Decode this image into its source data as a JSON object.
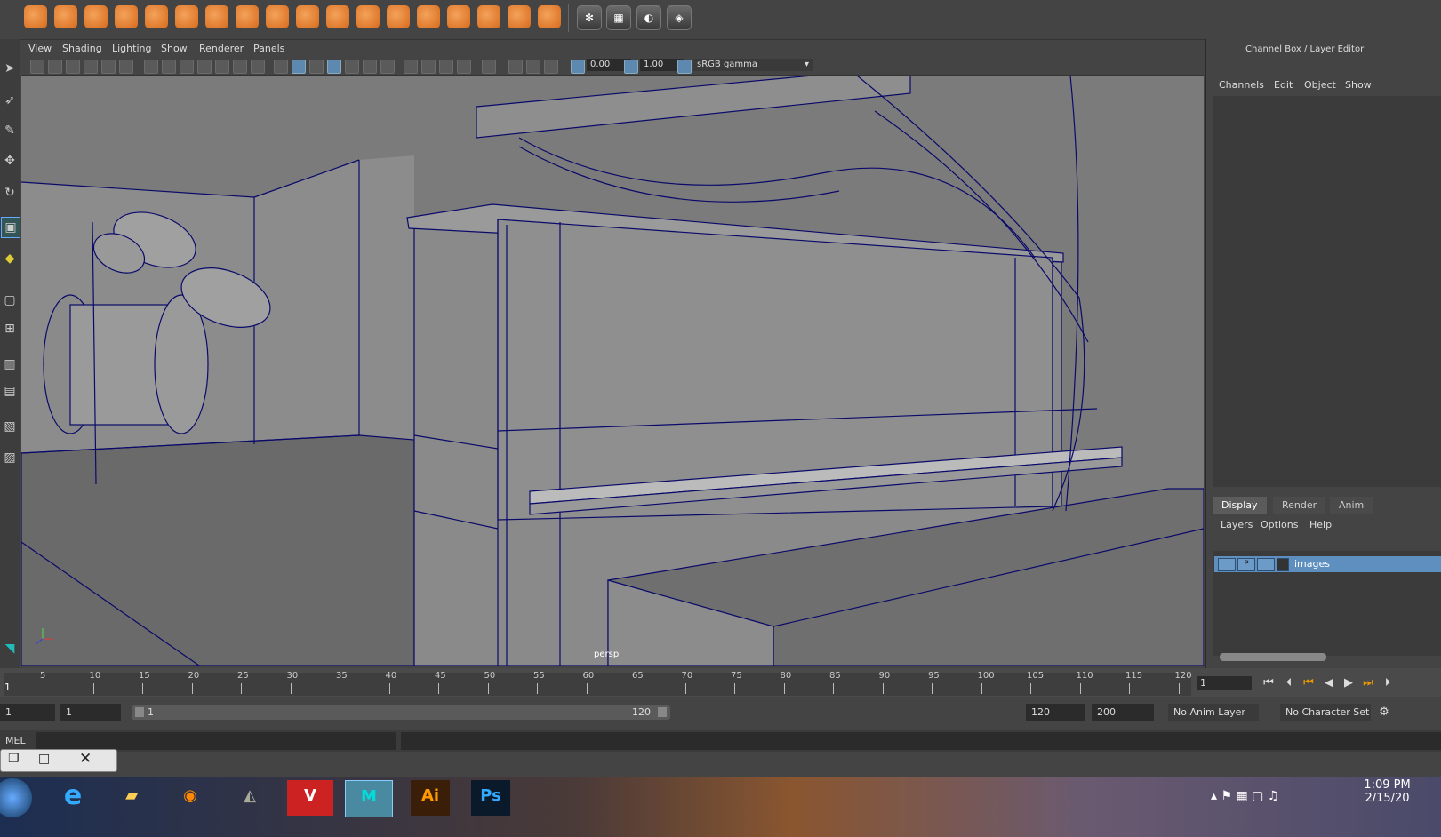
{
  "viewport_menu": [
    "View",
    "Shading",
    "Lighting",
    "Show",
    "Renderer",
    "Panels"
  ],
  "viewport_toolbar": {
    "exposure": "0.00",
    "gamma": "1.00",
    "color_space": "sRGB gamma"
  },
  "viewport": {
    "camera_label": "persp"
  },
  "right_panel": {
    "title": "Channel Box / Layer Editor",
    "channel_menu": [
      "Channels",
      "Edit",
      "Object",
      "Show"
    ],
    "tabs": [
      "Display",
      "Render",
      "Anim"
    ],
    "layer_menu": [
      "Layers",
      "Options",
      "Help"
    ],
    "layer": {
      "name": "images",
      "p_label": "P"
    }
  },
  "timeline": {
    "ticks": [
      "5",
      "10",
      "15",
      "20",
      "25",
      "30",
      "35",
      "40",
      "45",
      "50",
      "55",
      "60",
      "65",
      "70",
      "75",
      "80",
      "85",
      "90",
      "95",
      "100",
      "105",
      "110",
      "115",
      "120"
    ],
    "start_frame_label": "1",
    "current_frame": "1"
  },
  "range": {
    "start": "1",
    "playback_start": "1",
    "slider_start": "1",
    "slider_end": "120",
    "playback_end": "120",
    "end": "200",
    "anim_layer": "No Anim Layer",
    "character_set": "No Character Set"
  },
  "command_line": {
    "label": "MEL"
  },
  "taskbar": {
    "apps": [
      "windows-start",
      "internet-explorer",
      "file-explorer",
      "blender",
      "gimp",
      "vectorworks",
      "maya",
      "illustrator",
      "photoshop"
    ],
    "illustrator_label": "Ai",
    "photoshop_label": "Ps",
    "time": "1:09 PM",
    "date": "2/15/20"
  },
  "colors": {
    "accent": "#5e8fbf",
    "viewport_bg": "#7b7b7b",
    "wireframe": "#0a0a6a"
  }
}
